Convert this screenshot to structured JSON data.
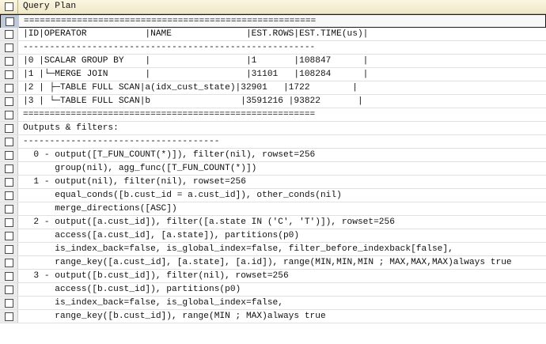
{
  "column_header": "Query Plan",
  "rows": [
    "=======================================================",
    "|ID|OPERATOR           |NAME              |EST.ROWS|EST.TIME(us)|",
    "-------------------------------------------------------",
    "|0 |SCALAR GROUP BY    |                  |1       |108847      |",
    "|1 |└─MERGE JOIN       |                  |31101   |108284      |",
    "|2 | ├─TABLE FULL SCAN|a(idx_cust_state)|32901   |1722        |",
    "|3 | └─TABLE FULL SCAN|b                 |3591216 |93822       |",
    "=======================================================",
    "Outputs & filters:",
    "-------------------------------------",
    "  0 - output([T_FUN_COUNT(*)]), filter(nil), rowset=256",
    "      group(nil), agg_func([T_FUN_COUNT(*)])",
    "  1 - output(nil), filter(nil), rowset=256",
    "      equal_conds([b.cust_id = a.cust_id]), other_conds(nil)",
    "      merge_directions([ASC])",
    "  2 - output([a.cust_id]), filter([a.state IN ('C', 'T')]), rowset=256",
    "      access([a.cust_id], [a.state]), partitions(p0)",
    "      is_index_back=false, is_global_index=false, filter_before_indexback[false],",
    "      range_key([a.cust_id], [a.state], [a.id]), range(MIN,MIN,MIN ; MAX,MAX,MAX)always true",
    "  3 - output([b.cust_id]), filter(nil), rowset=256",
    "      access([b.cust_id]), partitions(p0)",
    "      is_index_back=false, is_global_index=false,",
    "      range_key([b.cust_id]), range(MIN ; MAX)always true"
  ]
}
